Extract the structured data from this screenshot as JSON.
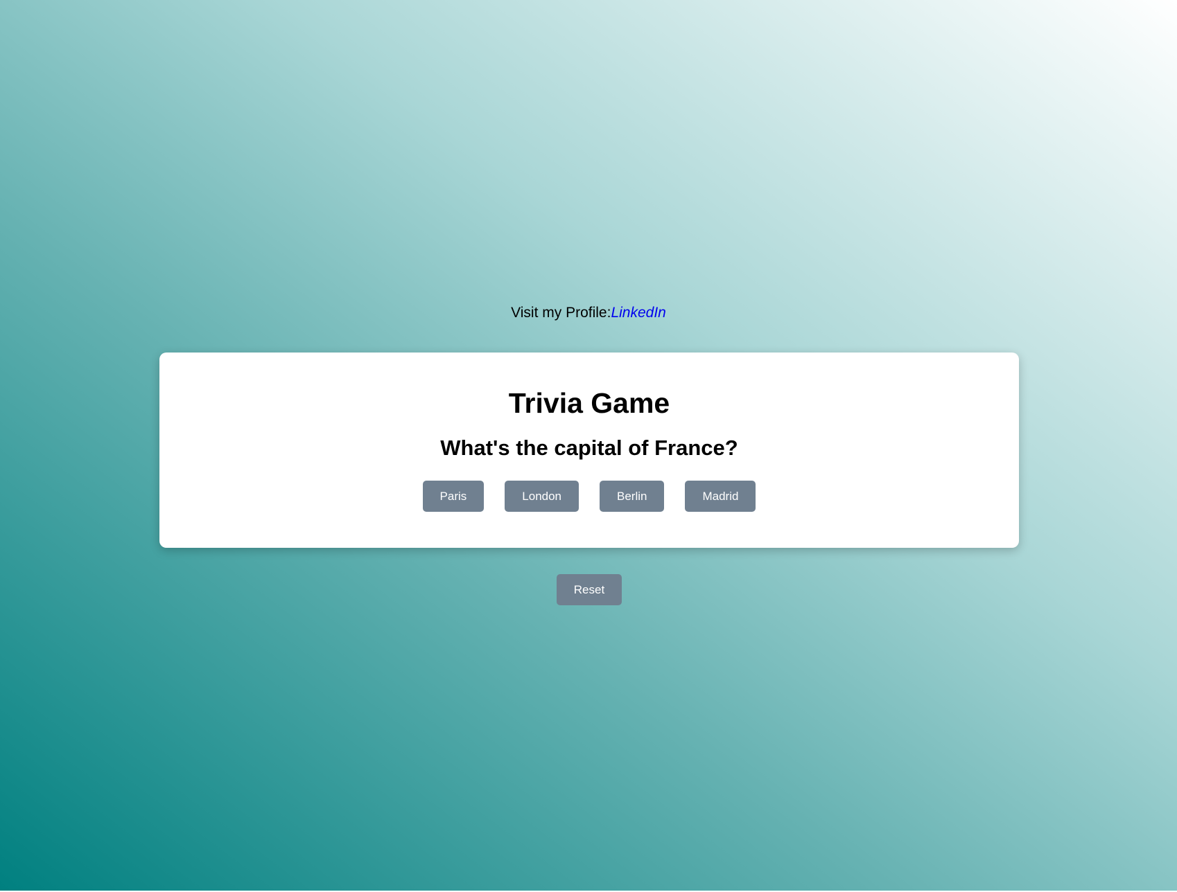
{
  "profile": {
    "label": "Visit my Profile:",
    "link_text": "LinkedIn"
  },
  "game": {
    "title": "Trivia Game",
    "question": "What's the capital of France?",
    "answers": [
      "Paris",
      "London",
      "Berlin",
      "Madrid"
    ]
  },
  "controls": {
    "reset_label": "Reset"
  },
  "colors": {
    "button": "#708090",
    "link": "#0000ee",
    "gradient_start": "#008080",
    "gradient_end": "#ffffff"
  }
}
